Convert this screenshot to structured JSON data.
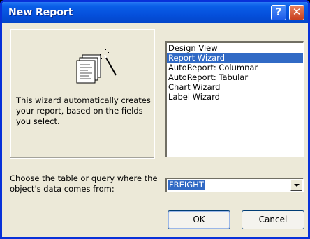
{
  "window": {
    "title": "New Report",
    "help_label": "?",
    "close_label": "✕"
  },
  "preview": {
    "icon": "report-wizard-icon",
    "description": "This wizard automatically creates your report, based on the fields you select."
  },
  "report_types": [
    {
      "label": "Design View",
      "selected": false
    },
    {
      "label": "Report Wizard",
      "selected": true
    },
    {
      "label": "AutoReport:  Columnar",
      "selected": false
    },
    {
      "label": "AutoReport:  Tabular",
      "selected": false
    },
    {
      "label": "Chart Wizard",
      "selected": false
    },
    {
      "label": "Label Wizard",
      "selected": false
    }
  ],
  "source": {
    "label": "Choose the table or query where the object's data comes from:",
    "value": "FREIGHT"
  },
  "buttons": {
    "ok": "OK",
    "cancel": "Cancel"
  },
  "colors": {
    "title_bar": "#0550dc",
    "selection": "#316ac5",
    "dialog_bg": "#ece9d8"
  }
}
